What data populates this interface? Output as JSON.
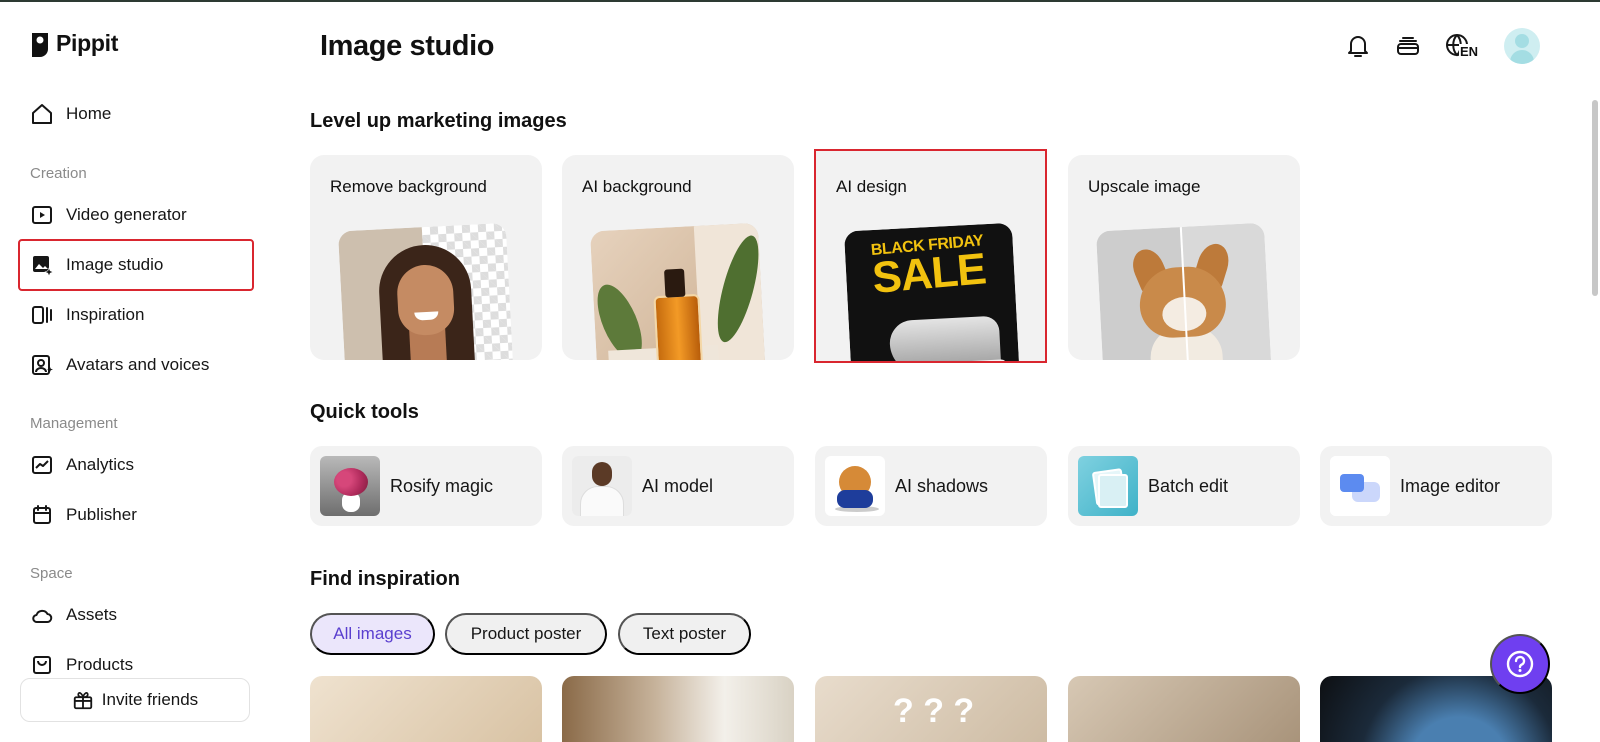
{
  "app": {
    "name": "Pippit"
  },
  "header": {
    "title": "Image studio",
    "language": "EN"
  },
  "sidebar": {
    "items": [
      {
        "label": "Home"
      },
      {
        "label": "Video generator"
      },
      {
        "label": "Image studio"
      },
      {
        "label": "Inspiration"
      },
      {
        "label": "Avatars and voices"
      },
      {
        "label": "Analytics"
      },
      {
        "label": "Publisher"
      },
      {
        "label": "Assets"
      },
      {
        "label": "Products"
      }
    ],
    "sections": [
      "Creation",
      "Management",
      "Space"
    ],
    "invite_label": "Invite friends"
  },
  "main": {
    "level_up": {
      "heading": "Level up marketing images",
      "cards": [
        {
          "label": "Remove background"
        },
        {
          "label": "AI background"
        },
        {
          "label": "AI design",
          "poster_line1": "BLACK FRIDAY",
          "poster_line2": "SALE"
        },
        {
          "label": "Upscale image"
        }
      ]
    },
    "quick_tools": {
      "heading": "Quick tools",
      "items": [
        {
          "label": "Rosify magic"
        },
        {
          "label": "AI model"
        },
        {
          "label": "AI shadows"
        },
        {
          "label": "Batch edit"
        },
        {
          "label": "Image editor"
        }
      ]
    },
    "inspiration": {
      "heading": "Find inspiration",
      "filters": [
        {
          "label": "All images",
          "active": true
        },
        {
          "label": "Product poster",
          "active": false
        },
        {
          "label": "Text poster",
          "active": false
        }
      ],
      "tile_question_marks": "? ? ?"
    }
  },
  "colors": {
    "highlight": "#d9262f",
    "accent": "#6f3ff0",
    "chip_active_bg": "#ebe6fb",
    "chip_active_text": "#5a3fcf"
  },
  "icons": {
    "home": "home-icon",
    "video": "video-play-icon",
    "image": "image-sparkle-icon",
    "inspiration": "inspiration-icon",
    "avatar": "avatar-icon",
    "analytics": "chart-line-icon",
    "publisher": "calendar-icon",
    "assets": "cloud-icon",
    "products": "bag-icon",
    "gift": "gift-icon",
    "bell": "bell-icon",
    "credits": "stack-icon",
    "globe": "globe-icon",
    "help": "help-question-icon"
  }
}
